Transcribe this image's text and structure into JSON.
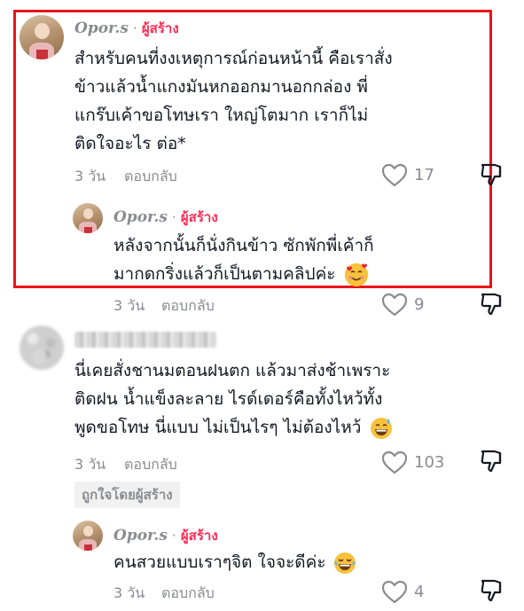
{
  "comment1": {
    "username": "Opor.s",
    "separator": "·",
    "badge": "ผู้สร้าง",
    "lines": [
      "สำหรับคนที่งงเหตุการณ์ก่อนหน้านี้ คือเราสั่ง",
      "ข้าวแล้วน้ำแกงมันหกออกมานอกกล่อง พี่",
      "แกร๊บเค้าขอโทษเรา ใหญ่โตมาก เราก็ไม่",
      "ติดใจอะไร ต่อ*"
    ],
    "time": "3 วัน",
    "reply": "ตอบกลับ",
    "likes": "17"
  },
  "reply1": {
    "username": "Opor.s",
    "separator": "·",
    "badge": "ผู้สร้าง",
    "lines": [
      "หลังจากนั้นก็นั่งกินข้าว ซักพักพี่เค้าก็",
      "มากดกริ่งแล้วก็เป็นตามคลิปค่ะ"
    ],
    "emoji": "smiling-face-with-hearts",
    "time": "3 วัน",
    "reply": "ตอบกลับ",
    "likes": "9"
  },
  "comment2": {
    "lines": [
      "นี่เคยสั่งชานมตอนฝนตก แล้วมาส่งช้าเพราะ",
      "ติดฝน น้ำแข็งละลาย ไรด์เดอร์คือทั้งไหว้ทั้ง",
      "พูดขอโทษ นี่แบบ ไม่เป็นไรๆ ไม่ต้องไหว้"
    ],
    "emoji": "grinning-sweat",
    "time": "3 วัน",
    "reply": "ตอบกลับ",
    "likes": "103",
    "liked_by_creator": "ถูกใจโดยผู้สร้าง"
  },
  "reply2": {
    "username": "Opor.s",
    "separator": "·",
    "badge": "ผู้สร้าง",
    "lines": [
      "คนสวยแบบเราๆจิต ใจจะดีค่ะ"
    ],
    "emoji": "tears-of-joy",
    "time": "3 วัน",
    "reply": "ตอบกลับ",
    "likes": "4"
  },
  "colors": {
    "highlight_border": "#e8151b",
    "creator_badge": "#fe2c55",
    "muted_text": "#8a8b91",
    "body_text": "#161823"
  }
}
